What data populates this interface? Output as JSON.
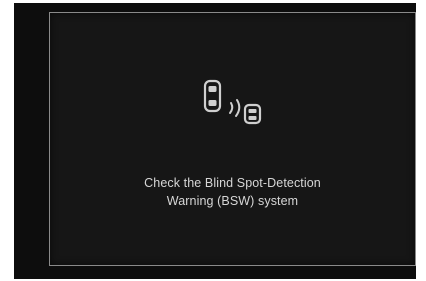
{
  "warning": {
    "icon": "blind-spot-warning-icon",
    "message_line1": "Check the Blind Spot-Detection",
    "message_line2": "Warning (BSW) system"
  },
  "colors": {
    "background": "#0d0d0d",
    "panel": "#161616",
    "border": "#8a8a8a",
    "text": "#d6d6d6",
    "icon": "#cfcfcf"
  }
}
